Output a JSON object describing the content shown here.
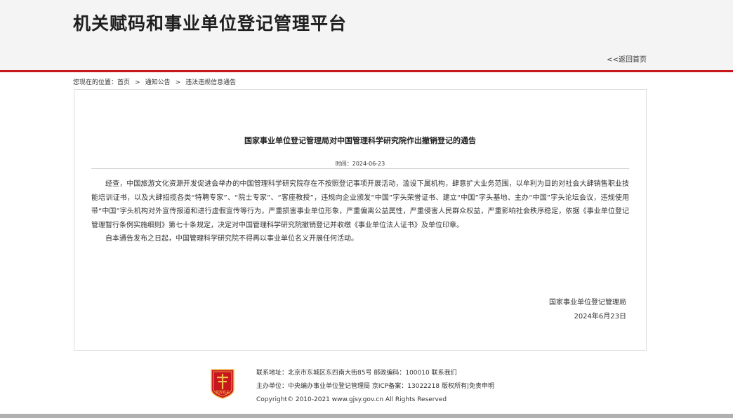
{
  "header": {
    "site_title": "机关赋码和事业单位登记管理平台",
    "back_link": "<<返回首页"
  },
  "breadcrumb": {
    "prefix": "您现在的位置：",
    "items": [
      "首页",
      "通知公告",
      "违法违规信息通告"
    ],
    "separator": ">"
  },
  "article": {
    "title": "国家事业单位登记管理局对中国管理科学研究院作出撤销登记的通告",
    "date": "时间：2024-06-23",
    "paragraphs": [
      "经查，中国旅游文化资源开发促进会举办的中国管理科学研究院存在不按照登记事项开展活动，滥设下属机构，肆意扩大业务范围，以牟利为目的对社会大肆销售职业技能培训证书，以及大肆招揽各类“特聘专家”、“院士专家”、“客座教授”，违规向企业颁发“中国”字头荣誉证书、建立“中国”字头基地、主办“中国”字头论坛会议，违规使用带“中国”字头机构对外宣传报道和进行虚假宣传等行为，严重损害事业单位形象，严重偏离公益属性，严重侵害人民群众权益，严重影响社会秩序稳定，依据《事业单位登记管理暂行条例实施细则》第七十条规定，决定对中国管理科学研究院撤销登记并收缴《事业单位法人证书》及单位印章。",
      "自本通告发布之日起，中国管理科学研究院不得再以事业单位名义开展任何活动。"
    ],
    "signature_org": "国家事业单位登记管理局",
    "signature_date": "2024年6月23日"
  },
  "footer": {
    "logo_text": "党政机关",
    "address_label": "联系地址：",
    "address": "北京市东城区东四南大街85号",
    "postcode_label": "邮政编码：",
    "postcode": "100010",
    "contact_link": "联系我们",
    "host_label": "主办单位：",
    "host": "中央编办事业单位登记管理局",
    "icp": "京ICP备案：13022218",
    "rights_link": "版权所有",
    "disclaimer_link": "免责申明",
    "copyright": "Copyright© 2010-2021 www.gjsy.gov.cn All Rights Reserved"
  },
  "colors": {
    "accent_red": "#c8161d",
    "header_bg": "#f4f4f4",
    "logo_red": "#c8161d",
    "logo_gold": "#f2c14e"
  },
  "icons": {
    "footer_logo": "party-government-emblem-icon"
  }
}
